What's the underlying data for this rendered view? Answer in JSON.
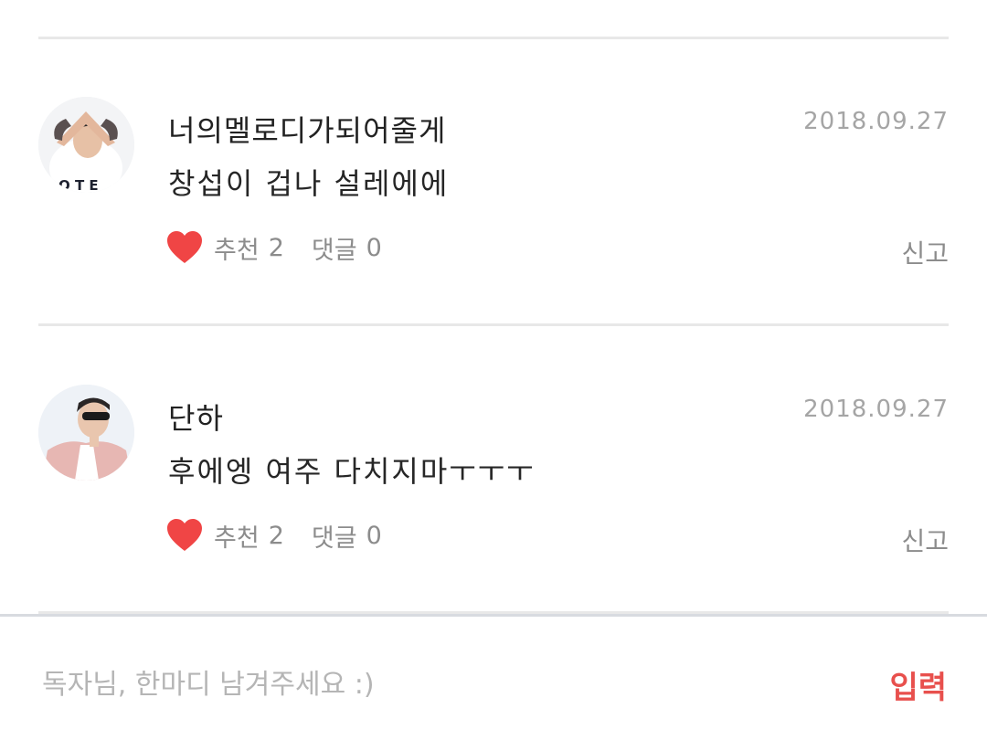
{
  "comments": [
    {
      "author": "너의멜로디가되어줄게",
      "date": "2018.09.27",
      "text": "창섭이 겁나 설레에에",
      "like_label": "추천",
      "like_count": "2",
      "reply_label": "댓글",
      "reply_count": "0",
      "report_label": "신고",
      "avatar_icon": "user-avatar-heart-hands"
    },
    {
      "author": "단하",
      "date": "2018.09.27",
      "text": "후에엥 여주 다치지마ㅜㅜㅜ",
      "like_label": "추천",
      "like_count": "2",
      "reply_label": "댓글",
      "reply_count": "0",
      "report_label": "신고",
      "avatar_icon": "user-avatar-sunglasses"
    }
  ],
  "input": {
    "placeholder": "독자님, 한마디 남겨주세요 :)",
    "value": "",
    "submit_label": "입력"
  },
  "colors": {
    "heart": "#f04545",
    "submit": "#e8504d",
    "meta_text": "#8c8c8c",
    "date_text": "#a5a5a5",
    "divider": "#e8e8e8"
  }
}
